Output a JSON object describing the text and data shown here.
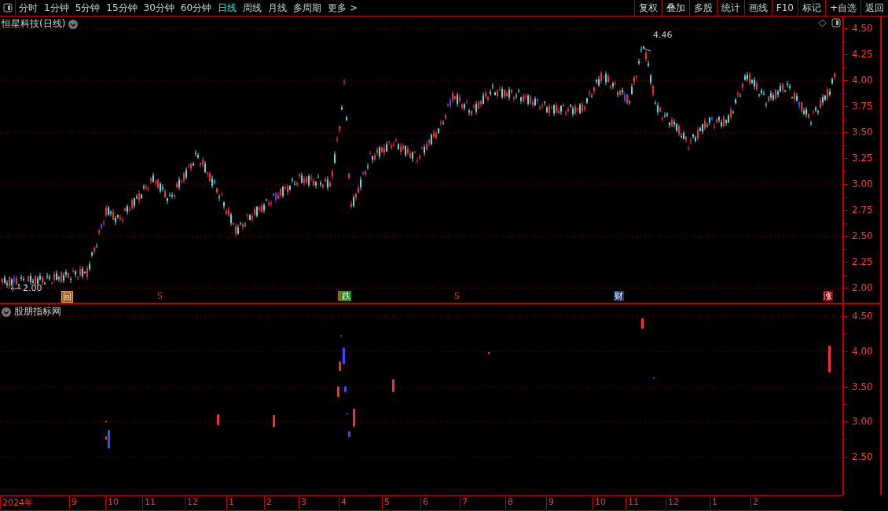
{
  "toolbar": {
    "periods": [
      {
        "label": "分时",
        "selected": false
      },
      {
        "label": "1分钟",
        "selected": false
      },
      {
        "label": "5分钟",
        "selected": false
      },
      {
        "label": "15分钟",
        "selected": false
      },
      {
        "label": "30分钟",
        "selected": false
      },
      {
        "label": "60分钟",
        "selected": false
      },
      {
        "label": "日线",
        "selected": true
      },
      {
        "label": "周线",
        "selected": false
      },
      {
        "label": "月线",
        "selected": false
      },
      {
        "label": "多周期",
        "selected": false
      },
      {
        "label": "更多 >",
        "selected": false
      }
    ],
    "buttons": [
      "复权",
      "叠加",
      "多股",
      "统计",
      "画线",
      "F10",
      "标记",
      "+自选",
      "返回"
    ]
  },
  "main_panel": {
    "title": "恒星科技(日线)",
    "high_label": "4.46",
    "low_label": "2.00",
    "markers": [
      {
        "kind": "review",
        "text": "回"
      },
      {
        "kind": "sell",
        "text": "S"
      },
      {
        "kind": "fall",
        "text": "跌"
      },
      {
        "kind": "sell",
        "text": "S"
      },
      {
        "kind": "finance",
        "text": "财"
      },
      {
        "kind": "rise",
        "text": "涨"
      }
    ],
    "y_ticks": [
      "4.50",
      "4.25",
      "4.00",
      "3.75",
      "3.50",
      "3.25",
      "3.00",
      "2.75",
      "2.50",
      "2.25",
      "2.00"
    ]
  },
  "indicator_panel": {
    "title": "股朋指标网",
    "y_ticks": [
      "4.50",
      "4.00",
      "3.50",
      "3.00",
      "2.50"
    ]
  },
  "x_axis": {
    "labels": [
      "2024年",
      "9",
      "10",
      "11",
      "12",
      "1",
      "2",
      "3",
      "4",
      "5",
      "6",
      "7",
      "8",
      "9",
      "10",
      "11",
      "12",
      "1",
      "2"
    ]
  }
}
